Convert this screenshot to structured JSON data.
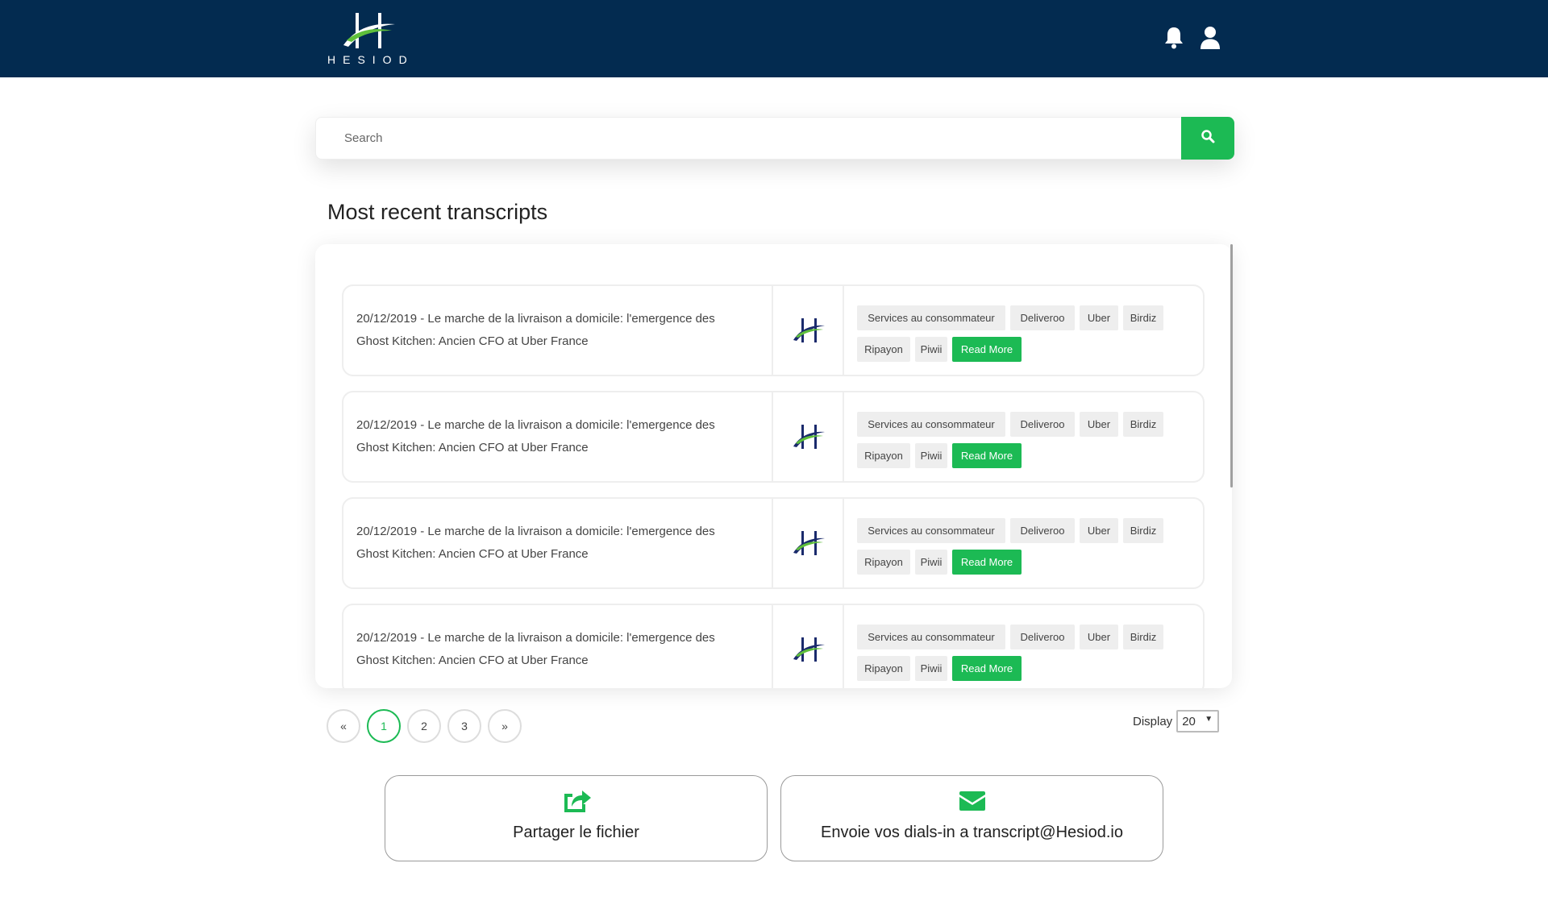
{
  "header": {
    "logo_text": "HESIOD",
    "bell_icon": "bell-icon",
    "user_icon": "user-icon",
    "background_color": "#032b50"
  },
  "search": {
    "placeholder": "Search",
    "value": "",
    "button_icon": "search-icon",
    "accent_color": "#1cba54"
  },
  "main": {
    "section_title": "Most recent transcripts",
    "transcripts": [
      {
        "title_line1": "20/12/2019 - Le marche de la livraison a domicile: l'emergence des",
        "title_line2": "Ghost Kitchen: Ancien CFO at Uber France",
        "tags": [
          "Services au consommateur",
          "Deliveroo",
          "Uber",
          "Birdiz",
          "Ripayon",
          "Piwii"
        ],
        "read_more_label": "Read More"
      },
      {
        "title_line1": "20/12/2019 - Le marche de la livraison a domicile: l'emergence des",
        "title_line2": "Ghost Kitchen: Ancien CFO at Uber France",
        "tags": [
          "Services au consommateur",
          "Deliveroo",
          "Uber",
          "Birdiz",
          "Ripayon",
          "Piwii"
        ],
        "read_more_label": "Read More"
      },
      {
        "title_line1": "20/12/2019 - Le marche de la livraison a domicile: l'emergence des",
        "title_line2": "Ghost Kitchen: Ancien CFO at Uber France",
        "tags": [
          "Services au consommateur",
          "Deliveroo",
          "Uber",
          "Birdiz",
          "Ripayon",
          "Piwii"
        ],
        "read_more_label": "Read More"
      },
      {
        "title_line1": "20/12/2019 - Le marche de la livraison a domicile: l'emergence des",
        "title_line2": "Ghost Kitchen: Ancien CFO at Uber France",
        "tags": [
          "Services au consommateur",
          "Deliveroo",
          "Uber",
          "Birdiz",
          "Ripayon",
          "Piwii"
        ],
        "read_more_label": "Read More"
      }
    ]
  },
  "pagination": {
    "prev_label": "«",
    "pages": [
      "1",
      "2",
      "3"
    ],
    "current_page": "1",
    "next_label": "»"
  },
  "display": {
    "label": "Display",
    "selected": "20"
  },
  "actions": {
    "share_label": "Partager le fichier",
    "share_icon": "share-file-icon",
    "email_label": "Envoie vos dials-in a transcript@Hesiod.io",
    "email_icon": "envelope-icon"
  }
}
